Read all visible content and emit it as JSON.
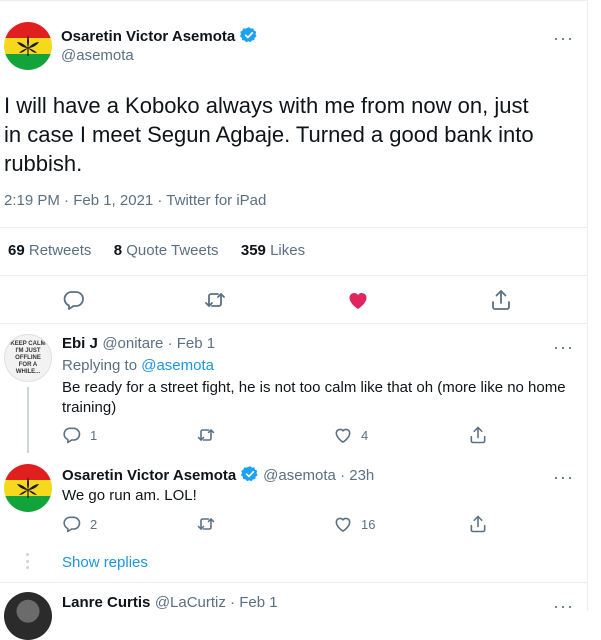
{
  "main_tweet": {
    "author_name": "Osaretin Victor Asemota",
    "handle": "@asemota",
    "text_line1": "I will have a Koboko always with me from now on, just",
    "text_line2": "in case I meet Segun Agbaje. Turned a good bank into",
    "text_line3": "rubbish.",
    "timestamp": "2:19 PM · Feb 1, 2021 · Twitter for iPad",
    "retweets_count": "69",
    "retweets_label": "Retweets",
    "quote_count": "8",
    "quote_label": "Quote Tweets",
    "likes_count": "359",
    "likes_label": "Likes",
    "more": "···"
  },
  "reply1": {
    "author_name": "Ebi J",
    "meta": "@onitare · Feb 1",
    "replying_prefix": "Replying to ",
    "replying_to": "@asemota",
    "text_line1": "Be ready for a street fight, he is not too calm like that oh (more like no home",
    "text_line2": "training)",
    "reply_count": "1",
    "like_count": "4",
    "avatar_text": "KEEP CALM I'M JUST OFFLINE FOR A WHILE...",
    "more": "···"
  },
  "reply2": {
    "author_name": "Osaretin Victor Asemota",
    "meta": "@asemota · 23h",
    "text": "We go run am. LOL!",
    "reply_count": "2",
    "like_count": "16",
    "more": "···"
  },
  "show_replies": "Show replies",
  "reply3": {
    "author_name": "Lanre Curtis",
    "meta": "@LaCurtiz · Feb 1",
    "more": "···"
  },
  "colors": {
    "like_active": "#e0245e",
    "link": "#1b95e0",
    "muted": "#5b7083",
    "verified": "#1da1f2"
  }
}
